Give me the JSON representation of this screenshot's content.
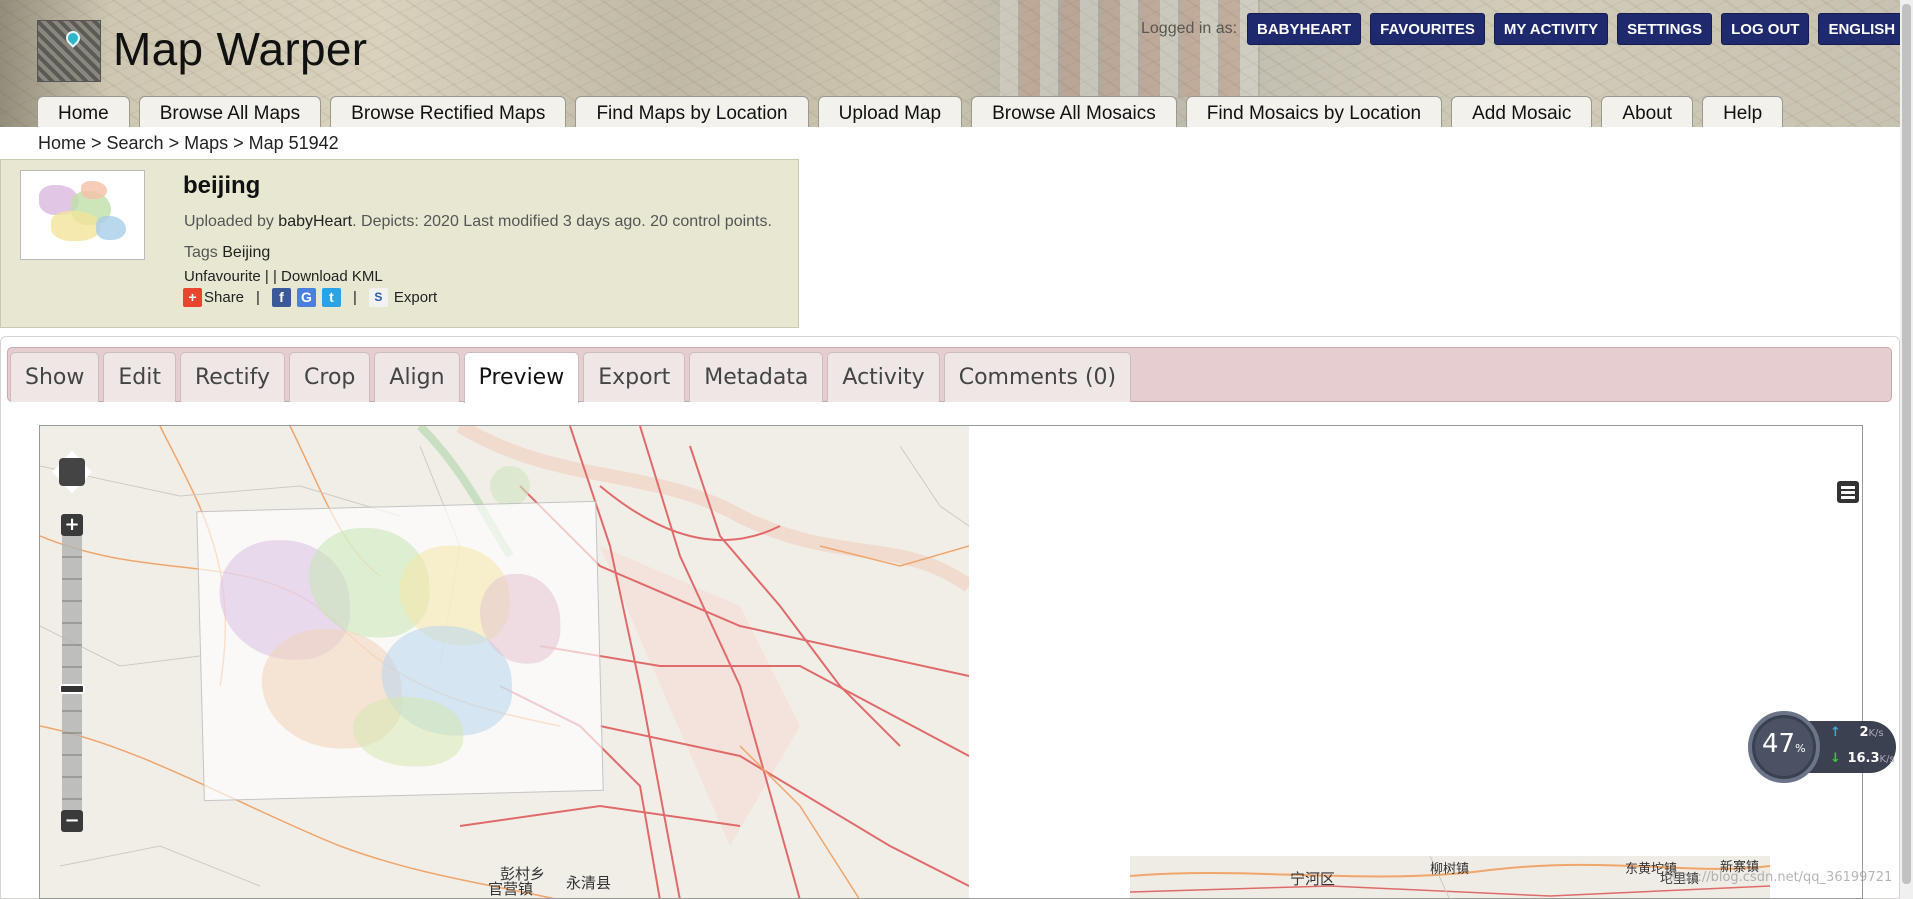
{
  "header": {
    "site_title": "Map Warper",
    "logged_in_label": "Logged in as:",
    "user_menu": [
      "BABYHEART",
      "FAVOURITES",
      "MY ACTIVITY",
      "SETTINGS",
      "LOG OUT",
      "ENGLISH (EN)"
    ],
    "nav": [
      "Home",
      "Browse All Maps",
      "Browse Rectified Maps",
      "Find Maps by Location",
      "Upload Map",
      "Browse All Mosaics",
      "Find Mosaics by Location",
      "Add Mosaic",
      "About",
      "Help"
    ]
  },
  "breadcrumb": [
    "Home",
    "Search",
    "Maps",
    "Map 51942"
  ],
  "map_info": {
    "title": "beijing",
    "uploaded_by_label": "Uploaded by",
    "uploader": "babyHeart",
    "details": ". Depicts: 2020 Last modified 3 days ago. 20 control points.",
    "tags_label": "Tags",
    "tag": "Beijing",
    "unfavourite": "Unfavourite",
    "sep1": "| |",
    "download_kml": "Download KML",
    "share": "Share",
    "pipe": "|",
    "export": "Export"
  },
  "tabs": [
    "Show",
    "Edit",
    "Rectify",
    "Crop",
    "Align",
    "Preview",
    "Export",
    "Metadata",
    "Activity",
    "Comments (0)"
  ],
  "active_tab": "Preview",
  "map_labels": {
    "l1": "永清县",
    "l2": "彭村乡",
    "l3": "官营镇",
    "l4": "宁河区",
    "l5": "柳树镇",
    "l6": "东黄坨镇",
    "l7": "坨里镇",
    "l8": "新寨镇"
  },
  "speed_widget": {
    "percent": "47",
    "percent_unit": "%",
    "up": "2",
    "down": "16.3",
    "unit": "K/s"
  },
  "watermark": "https://blog.csdn.net/qq_36199721",
  "colors": {
    "userbtn_bg": "#1f2a6e",
    "infobox_bg": "#e8e8d2",
    "tabbar_bg": "#e5cdd0"
  }
}
